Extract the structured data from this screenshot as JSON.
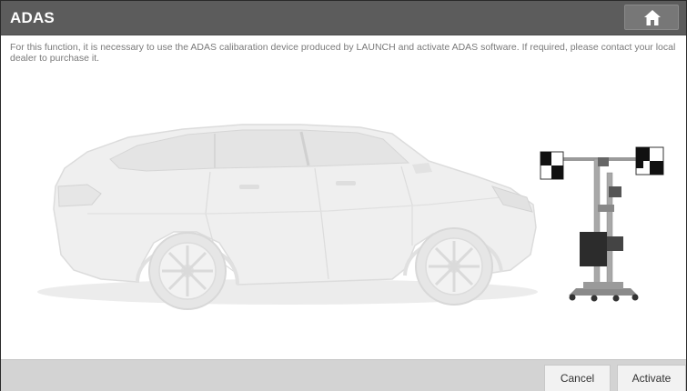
{
  "header": {
    "title": "ADAS",
    "home_icon": "home-icon"
  },
  "notice": {
    "text": "For this function, it is necessary to use the ADAS calibaration device produced by LAUNCH and activate ADAS software. If required, please contact your local dealer to purchase it."
  },
  "illustration": {
    "car": "suv-illustration",
    "device": "adas-calibration-frame"
  },
  "footer": {
    "cancel_label": "Cancel",
    "activate_label": "Activate"
  },
  "colors": {
    "titlebar": "#5c5c5c",
    "footer": "#d3d3d3",
    "button": "#f2f2f2"
  }
}
